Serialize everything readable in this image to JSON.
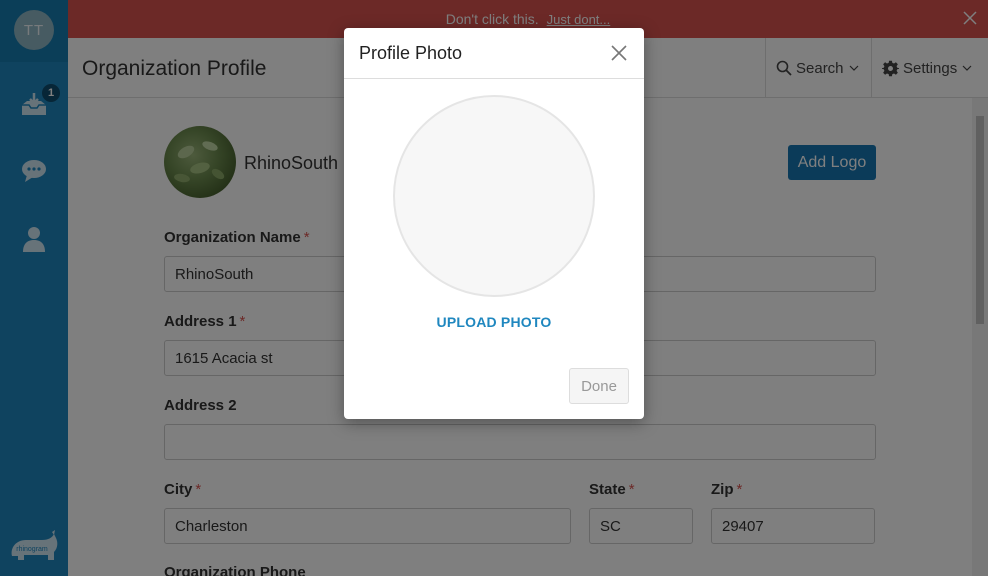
{
  "sidebar": {
    "avatar_initials": "TT",
    "inbox_badge": "1",
    "logo_text": "rhinogram"
  },
  "banner": {
    "message": "Don't click this.",
    "link": "Just dont..."
  },
  "header": {
    "title": "Organization Profile",
    "search_label": "Search",
    "settings_label": "Settings"
  },
  "profile": {
    "org_name": "RhinoSouth",
    "add_logo_label": "Add Logo"
  },
  "form": {
    "org_name_label": "Organization Name",
    "org_name_value": "RhinoSouth",
    "address1_label": "Address 1",
    "address1_value": "1615 Acacia st",
    "address2_label": "Address 2",
    "address2_value": "",
    "city_label": "City",
    "city_value": "Charleston",
    "state_label": "State",
    "state_value": "SC",
    "zip_label": "Zip",
    "zip_value": "29407",
    "phone_label": "Organization Phone",
    "required_mark": "*"
  },
  "modal": {
    "title": "Profile Photo",
    "upload_label": "UPLOAD PHOTO",
    "done_label": "Done"
  },
  "colors": {
    "sidebar": "#1f87bf",
    "banner": "#d9534f",
    "primary_button": "#1677b3",
    "link": "#1f87bf"
  }
}
